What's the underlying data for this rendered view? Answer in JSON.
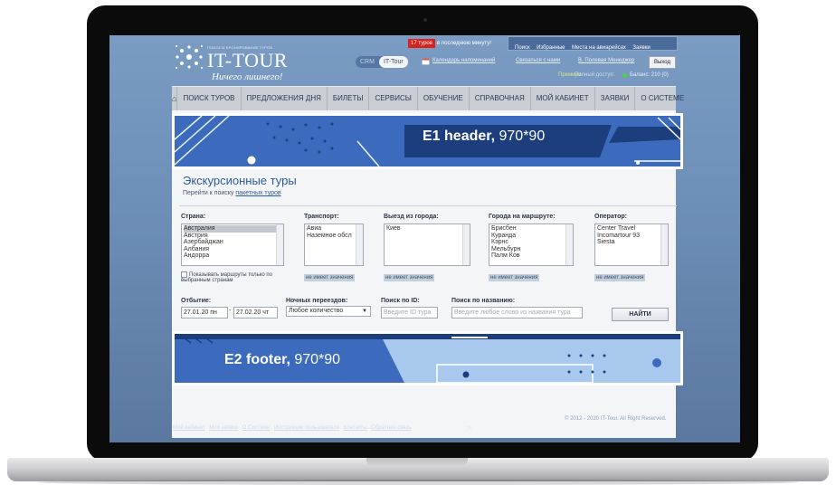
{
  "site": {
    "logo_sub": "ПОИСК И БРОНИРОВАНИЕ ТУРОВ",
    "logo_title": "IT-TOUR",
    "logo_slogan": "Ничего лишнего!",
    "red_badge": "17 туров",
    "red_badge_text": "в последнюю минуту!",
    "topnav": [
      "Поиск",
      "Избранные",
      "Места на авиарейсах",
      "Заявки"
    ],
    "crm_label": "CRM",
    "ittour_label": "IT-Tour",
    "calendar_link": "Календарь напоминаний",
    "contact_link": "Связаться с нами",
    "user_link": "В. Полевая Менеджер",
    "exit_label": "Выход",
    "promo_label": "Премиум",
    "full_access": "Полный доступ:",
    "balance": "Баланс: 210 (0)"
  },
  "mainnav": [
    "ПОИСК ТУРОВ",
    "ПРЕДЛОЖЕНИЯ ДНЯ",
    "БИЛЕТЫ",
    "СЕРВИСЫ",
    "ОБУЧЕНИЕ",
    "СПРАВОЧНАЯ",
    "МОЙ КАБИНЕТ",
    "ЗАЯВКИ",
    "О СИСТЕМЕ"
  ],
  "banners": {
    "header_bold": "E1 header,",
    "header_size": "970*90",
    "footer_bold": "E2 footer,",
    "footer_size": "970*90"
  },
  "content": {
    "title": "Экскурсионные туры",
    "subtitle": "Перейти к поиску",
    "subtitle_link": "пакетных туров",
    "filters": {
      "country_label": "Страна:",
      "countries": [
        "Австралия",
        "Австрия",
        "Азербайджан",
        "Албания",
        "Андорра"
      ],
      "checkbox_label": "Показывать маршруты только по выбранным странам",
      "transport_label": "Транспорт:",
      "transports": [
        "Авиа",
        "Наземное обсл"
      ],
      "departure_label": "Выезд из города:",
      "departures": [
        "Киев"
      ],
      "cities_label": "Города на маршруте:",
      "cities": [
        "Брисбен",
        "Куранда",
        "Кэрнс",
        "Мельбурн",
        "Палм Ков"
      ],
      "operator_label": "Оператор:",
      "operators": [
        "Center Travel",
        "Incomartour 93",
        "Siesta"
      ],
      "no_value": "не имеет значения"
    },
    "departure_date_label": "Отбытие:",
    "date_from": "27.01.20 пн",
    "date_to": "27.02.20 чт",
    "nights_label": "Ночных переездов:",
    "nights_value": "Любое количество",
    "id_label": "Поиск по ID:",
    "id_placeholder": "Введите ID тура",
    "name_label": "Поиск по названию:",
    "name_placeholder": "Введите любое слово из названия тура",
    "find_button": "НАЙТИ"
  },
  "footer": {
    "links": [
      "Мой кабинет",
      "Мои заявки",
      "О Системе",
      "Инструкции пользователя",
      "Контакты",
      "Обратная связь"
    ],
    "copyright": "© 2012 - 2020 IT-Tour. All Right Reserved."
  },
  "colors": {
    "banner_blue": "#3c6bbd",
    "banner_light": "#a9c8ee",
    "nav_bg": "#c9ced5",
    "screen_bg": "#6e8fb8"
  }
}
